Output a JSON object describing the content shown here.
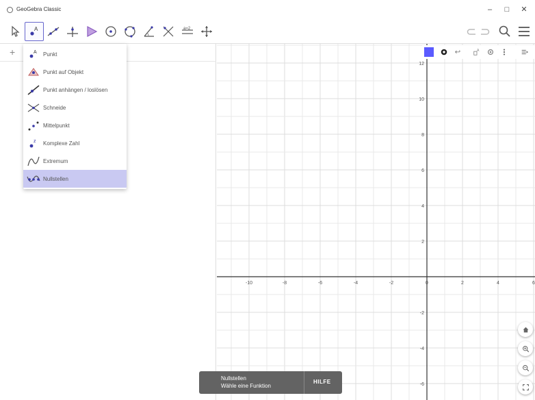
{
  "window": {
    "title": "GeoGebra Classic",
    "minimize": "–",
    "maximize": "□",
    "close": "✕"
  },
  "toolbar": {
    "tools": [
      {
        "name": "move-tool-icon",
        "active": false
      },
      {
        "name": "point-tool-icon",
        "active": true
      },
      {
        "name": "line-tool-icon",
        "active": false
      },
      {
        "name": "perpendicular-tool-icon",
        "active": false
      },
      {
        "name": "polygon-tool-icon",
        "active": false
      },
      {
        "name": "circle-center-tool-icon",
        "active": false
      },
      {
        "name": "circle-three-points-tool-icon",
        "active": false
      },
      {
        "name": "angle-tool-icon",
        "active": false
      },
      {
        "name": "reflect-tool-icon",
        "active": false
      },
      {
        "name": "slider-tool-icon",
        "active": false
      },
      {
        "name": "move-view-tool-icon",
        "active": false
      }
    ],
    "undo_icon": "undo-icon",
    "redo_icon": "redo-icon",
    "search_icon": "search-icon",
    "menu_icon": "hamburger-menu-icon"
  },
  "algebra": {
    "add_symbol": "+"
  },
  "point_menu": {
    "items": [
      {
        "label": "Punkt",
        "icon": "point-icon",
        "selected": false
      },
      {
        "label": "Punkt auf Objekt",
        "icon": "point-on-object-icon",
        "selected": false
      },
      {
        "label": "Punkt anhängen / loslösen",
        "icon": "attach-detach-point-icon",
        "selected": false
      },
      {
        "label": "Schneide",
        "icon": "intersect-icon",
        "selected": false
      },
      {
        "label": "Mittelpunkt",
        "icon": "midpoint-icon",
        "selected": false
      },
      {
        "label": "Komplexe Zahl",
        "icon": "complex-number-icon",
        "selected": false
      },
      {
        "label": "Extremum",
        "icon": "extremum-icon",
        "selected": false
      },
      {
        "label": "Nullstellen",
        "icon": "roots-icon",
        "selected": true
      }
    ]
  },
  "graphics": {
    "x_ticks": [
      "-10",
      "-8",
      "-6",
      "-4",
      "-2",
      "0",
      "2",
      "4",
      "6"
    ],
    "y_ticks": [
      "12",
      "10",
      "8",
      "6",
      "4",
      "2",
      "-2",
      "-4",
      "-6"
    ],
    "style_bar": {
      "color": "#5b5bff",
      "point_style_icon": "point-style-icon",
      "undo_small": "↩",
      "label_icon": "label-style-icon",
      "settings_icon": "gear-icon",
      "more_icon": "more-vert-icon",
      "toggle_icon": "toggle-style-bar-icon"
    },
    "home_icon": "home-icon",
    "zoom_in_icon": "zoom-in-icon",
    "zoom_out_icon": "zoom-out-icon",
    "fullscreen_icon": "fullscreen-icon"
  },
  "snackbar": {
    "title": "Nullstellen",
    "subtitle": "Wähle eine Funktion",
    "help": "HILFE"
  },
  "colors": {
    "accent": "#6666cc",
    "selected_bg": "#c9c9f2",
    "axis": "#333333",
    "grid": "#e8e8e8",
    "snackbar_bg": "#636363"
  }
}
